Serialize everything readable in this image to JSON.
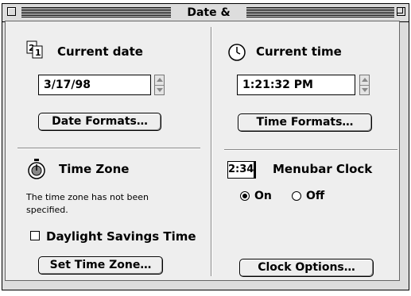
{
  "window": {
    "title": "Date & Time"
  },
  "date": {
    "heading": "Current date",
    "value": "3/17/98",
    "button": "Date Formats…"
  },
  "time": {
    "heading": "Current time",
    "value": "1:21:32 PM",
    "button": "Time Formats…"
  },
  "timezone": {
    "heading": "Time Zone",
    "message_line1": "The time zone has not been",
    "message_line2": "specified.",
    "dst_label": "Daylight Savings Time",
    "dst_checked": false,
    "button": "Set Time Zone…"
  },
  "menubar_clock": {
    "icon_text": "2:34",
    "heading": "Menubar Clock",
    "on_label": "On",
    "off_label": "Off",
    "selected": "On",
    "button": "Clock Options…"
  }
}
